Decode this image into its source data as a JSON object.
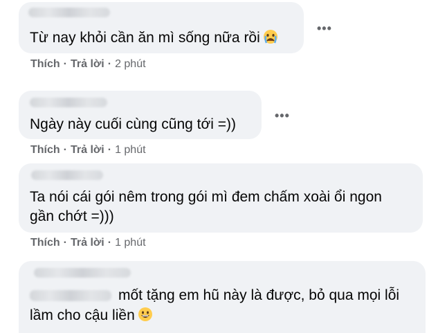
{
  "comments": [
    {
      "text": "Từ nay khỏi cần ăn mì sống nữa rồi",
      "emoji_icon": "crying-face-icon",
      "like_label": "Thích",
      "reply_label": "Trả lời",
      "separator": "·",
      "time": "2 phút"
    },
    {
      "text": "Ngày này cuối cùng cũng tới =))",
      "like_label": "Thích",
      "reply_label": "Trả lời",
      "separator": "·",
      "time": "1 phút"
    },
    {
      "text_line1": "Ta nói cái gói nêm trong gói mì đem chấm xoài ổi ngon",
      "text_line2": "gần chớt =)))",
      "like_label": "Thích",
      "reply_label": "Trả lời",
      "separator": "·",
      "time": "1 phút"
    },
    {
      "text_line1": "mốt tặng em hũ này là được, bỏ qua mọi lỗi",
      "text_line2": "lầm cho cậu liền",
      "emoji_icon": "grinning-face-icon"
    }
  ],
  "more_label": "•••",
  "colors": {
    "bubble_bg": "#f0f2f5",
    "text": "#050505",
    "secondary_text": "#65676b"
  }
}
